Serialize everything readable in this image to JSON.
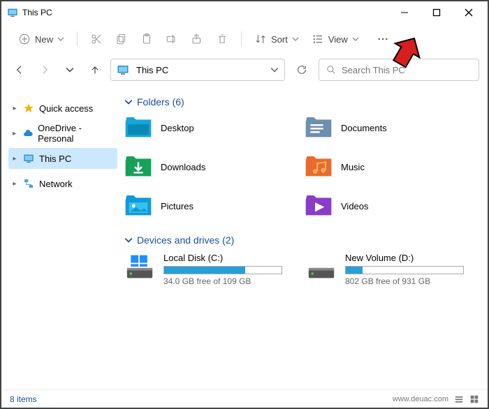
{
  "window": {
    "title": "This PC"
  },
  "toolbar": {
    "new_label": "New",
    "sort_label": "Sort",
    "view_label": "View"
  },
  "address": {
    "path": "This PC"
  },
  "search": {
    "placeholder": "Search This PC"
  },
  "sidebar": {
    "items": [
      {
        "label": "Quick access"
      },
      {
        "label": "OneDrive - Personal"
      },
      {
        "label": "This PC"
      },
      {
        "label": "Network"
      }
    ]
  },
  "groups": {
    "folders": {
      "heading": "Folders (6)",
      "items": [
        {
          "label": "Desktop"
        },
        {
          "label": "Documents"
        },
        {
          "label": "Downloads"
        },
        {
          "label": "Music"
        },
        {
          "label": "Pictures"
        },
        {
          "label": "Videos"
        }
      ]
    },
    "drives": {
      "heading": "Devices and drives (2)",
      "items": [
        {
          "name": "Local Disk (C:)",
          "free_text": "34.0 GB free of 109 GB",
          "fill_pct": 69
        },
        {
          "name": "New Volume (D:)",
          "free_text": "802 GB free of 931 GB",
          "fill_pct": 14
        }
      ]
    }
  },
  "status": {
    "items_text": "8 items",
    "watermark": "www.deuac.com"
  }
}
